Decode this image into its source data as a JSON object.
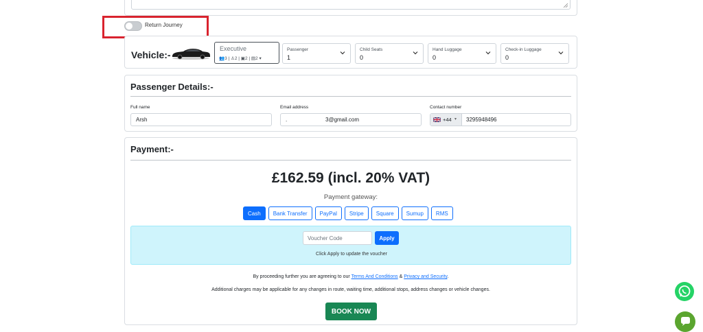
{
  "return_journey": {
    "label": "Return Journey",
    "enabled": false
  },
  "vehicle": {
    "title": "Vehicle:-",
    "selected": "Executive",
    "specs": [
      "3",
      "2",
      "2",
      "2"
    ],
    "fields": [
      {
        "label": "Passenger",
        "value": "1"
      },
      {
        "label": "Child Seats",
        "value": "0"
      },
      {
        "label": "Hand Luggage",
        "value": "0"
      },
      {
        "label": "Check-in Luggage",
        "value": "0"
      }
    ]
  },
  "passenger": {
    "title": "Passenger Details:-",
    "full_name_label": "Full name",
    "full_name": "Arsh",
    "email_label": "Email address",
    "email_prefix": ".",
    "email": "3@gmail.com",
    "contact_label": "Contact number",
    "dial_code": "+44",
    "phone": "3295948496"
  },
  "payment": {
    "title": "Payment:-",
    "price": "£162.59 (incl. 20% VAT)",
    "gateway_label": "Payment gateway:",
    "gateways": [
      "Cash",
      "Bank Transfer",
      "PayPal",
      "Stripe",
      "Square",
      "Sumup",
      "RMS"
    ],
    "active_gateway": "Cash",
    "voucher_placeholder": "Voucher Code",
    "apply_label": "Apply",
    "voucher_hint": "Click Apply to update the voucher",
    "terms_prefix": "By proceeding further you are agreeing to our ",
    "terms_link": "Terms And Conditions",
    "terms_and": " & ",
    "privacy_link": "Privacy and Security",
    "terms_suffix": ".",
    "charges_note": "Additional charges may be applicable for any changes in route, waiting time, additional stops, address changes or vehicle changes.",
    "book_label": "BOOK NOW"
  },
  "colors": {
    "primary": "#0d6efd",
    "success": "#198754",
    "highlight_box": "#d9232e",
    "voucher_bg": "#cff4fc",
    "whatsapp": "#25d366",
    "chat": "#5ba52f"
  }
}
